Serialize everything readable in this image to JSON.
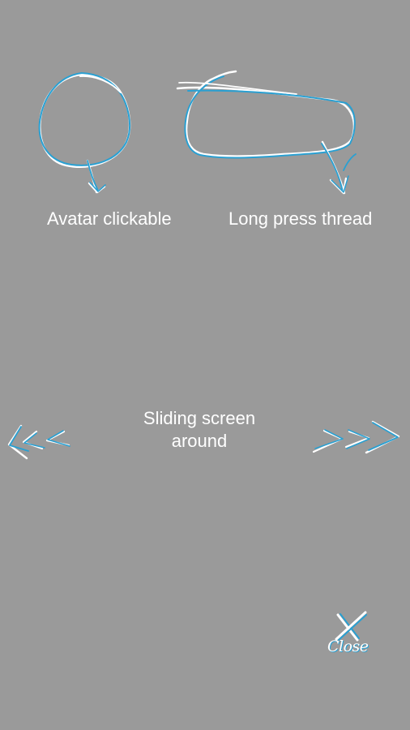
{
  "guide": {
    "avatar_label": "Avatar clickable",
    "thread_label": "Long press thread",
    "slide_label": "Sliding screen around",
    "close_label": "Close"
  },
  "icons": {
    "avatar_hint": "circle-icon",
    "thread_hint": "rounded-rect-icon",
    "left_swipe": "left-chevrons-icon",
    "right_swipe": "right-chevrons-icon",
    "close": "close-icon"
  },
  "colors": {
    "overlay_background": "#9a9a9a",
    "stroke_white": "#ffffff",
    "stroke_blue": "#2aa0d2"
  }
}
